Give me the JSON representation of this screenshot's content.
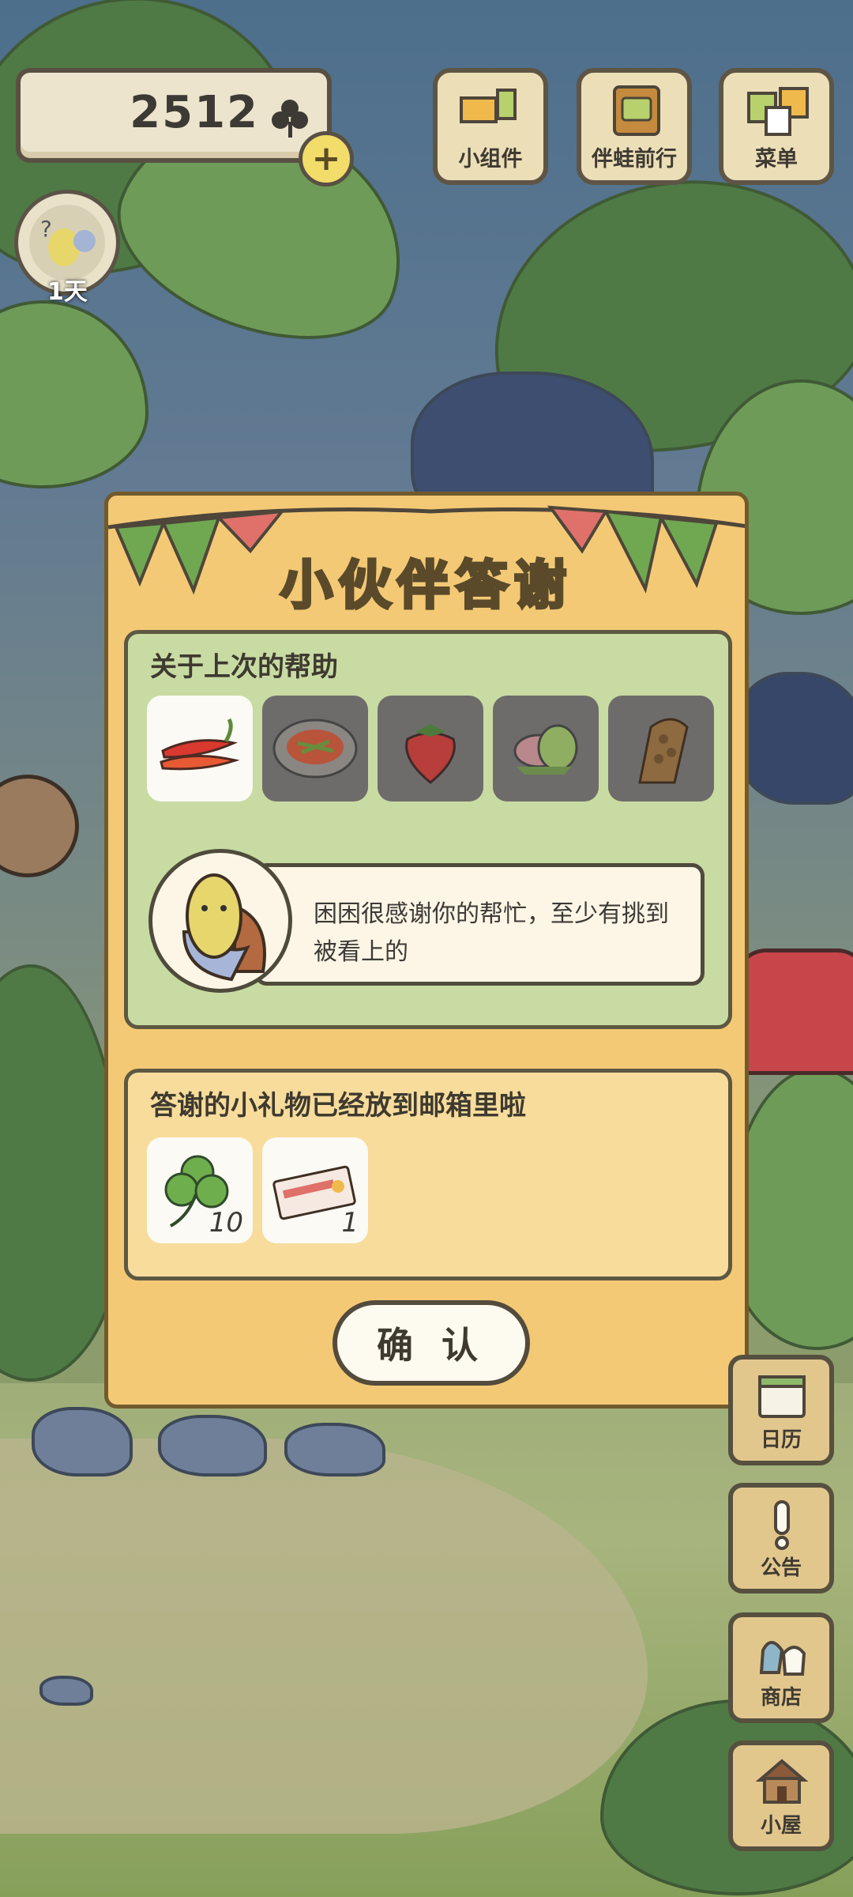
{
  "hud": {
    "clover_count": "2512",
    "avatar_day_label": "1天"
  },
  "top_buttons": [
    {
      "label": "小组件",
      "icon": "widget-icon"
    },
    {
      "label": "伴蛙前行",
      "icon": "journey-book-icon"
    },
    {
      "label": "菜单",
      "icon": "menu-cards-icon"
    }
  ],
  "modal": {
    "title": "小伙伴答谢",
    "help_section": {
      "heading": "关于上次的帮助",
      "items": [
        {
          "name": "chili-peppers",
          "selected": true
        },
        {
          "name": "salad-plate",
          "selected": false
        },
        {
          "name": "strawberry",
          "selected": false
        },
        {
          "name": "mochi",
          "selected": false
        },
        {
          "name": "rice-cracker",
          "selected": false
        }
      ],
      "speaker_icon": "bird-friend-portrait",
      "message": "困困很感谢你的帮忙，至少有挑到被看上的"
    },
    "gift_section": {
      "heading": "答谢的小礼物已经放到邮箱里啦",
      "gifts": [
        {
          "name": "clover",
          "count": "10"
        },
        {
          "name": "ticket",
          "count": "1"
        }
      ]
    },
    "confirm_label": "确 认"
  },
  "side_buttons": [
    {
      "label": "日历",
      "icon": "calendar-icon"
    },
    {
      "label": "公告",
      "icon": "notice-icon"
    },
    {
      "label": "商店",
      "icon": "shop-bags-icon"
    },
    {
      "label": "小屋",
      "icon": "house-icon"
    }
  ],
  "colors": {
    "modal_bg": "#f4c975",
    "panel_green": "#c8dba3",
    "panel_gift": "#f8dc9c",
    "pennant_green": "#6fa851",
    "pennant_red": "#e0706a"
  }
}
